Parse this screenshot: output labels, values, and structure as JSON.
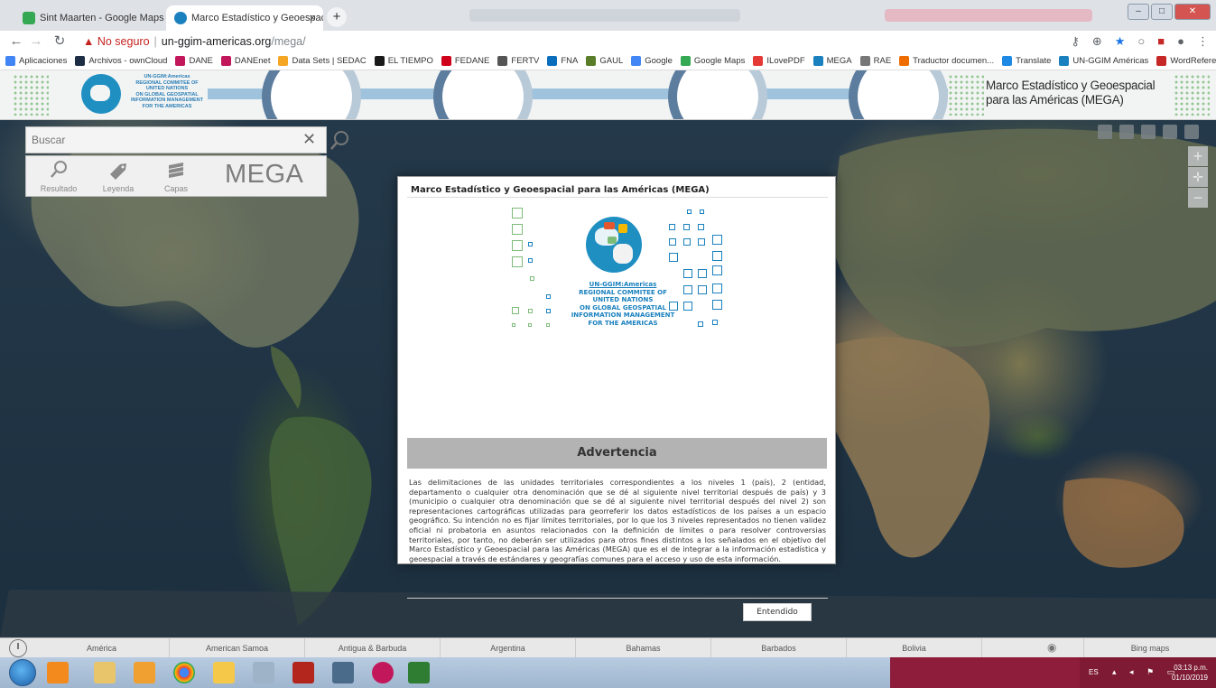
{
  "browser": {
    "tabs": [
      {
        "title": "Sint Maarten - Google Maps",
        "favicon_color": "#34a853"
      },
      {
        "title": "Marco Estadístico y Geoespacial",
        "favicon_color": "#1a81be"
      }
    ],
    "address": {
      "security_label": "No seguro",
      "host": "un-ggim-americas.org",
      "path": "/mega/"
    },
    "bookmarks": [
      {
        "label": "Aplicaciones",
        "color": "#4285f4"
      },
      {
        "label": "Archivos - ownCloud",
        "color": "#1d2d44"
      },
      {
        "label": "DANE",
        "color": "#c2185b"
      },
      {
        "label": "DANEnet",
        "color": "#c2185b"
      },
      {
        "label": "Data Sets | SEDAC",
        "color": "#f5a623"
      },
      {
        "label": "EL TIEMPO",
        "color": "#1a1a1a"
      },
      {
        "label": "FEDANE",
        "color": "#d0021b"
      },
      {
        "label": "FERTV",
        "color": "#555555"
      },
      {
        "label": "FNA",
        "color": "#0a6ebd"
      },
      {
        "label": "GAUL",
        "color": "#5a7d2a"
      },
      {
        "label": "Google",
        "color": "#4285f4"
      },
      {
        "label": "Google Maps",
        "color": "#34a853"
      },
      {
        "label": "ILovePDF",
        "color": "#e53935"
      },
      {
        "label": "MEGA",
        "color": "#1a81be"
      },
      {
        "label": "RAE",
        "color": "#777777"
      },
      {
        "label": "Traductor documen...",
        "color": "#ef6c00"
      },
      {
        "label": "Translate",
        "color": "#1e88e5"
      },
      {
        "label": "UN-GGIM Américas",
        "color": "#1a81be"
      },
      {
        "label": "WordReference",
        "color": "#c62828"
      }
    ]
  },
  "banner": {
    "org_lines": [
      "UN-GGIM:Americas",
      "REGIONAL COMMITEE OF",
      "UNITED NATIONS",
      "ON GLOBAL GEOSPATIAL",
      "INFORMATION MANAGEMENT",
      "FOR THE AMERICAS"
    ],
    "headline_line1": "Marco Estadístico y Geoespacial",
    "headline_line2": "para las Américas (MEGA)"
  },
  "search": {
    "placeholder": "Buscar"
  },
  "tools": {
    "resultado": "Resultado",
    "leyenda": "Leyenda",
    "capas": "Capas",
    "brand": "MEGA"
  },
  "modal": {
    "title": "Marco Estadístico y Geoespacial para las Américas (MEGA)",
    "logo_lines": [
      "UN-GGIM:Americas",
      "REGIONAL COMMITEE OF",
      "UNITED NATIONS",
      "ON GLOBAL GEOSPATIAL",
      "INFORMATION MANAGEMENT",
      "FOR THE AMERICAS"
    ],
    "heading": "Advertencia",
    "body": "Las delimitaciones de las unidades territoriales correspondientes a los niveles 1 (país), 2 (entidad, departamento o cualquier otra denominación que se dé al siguiente nivel territorial después de país) y 3 (municipio o cualquier otra denominación que se dé al siguiente nivel territorial después del nivel 2) son representaciones cartográficas utilizadas para georreferir los datos estadísticos de los países a un espacio geográfico. Su intención no es fijar límites territoriales, por lo que los 3 niveles representados no tienen validez oficial ni probatoria en asuntos relacionados con la definición de límites o para resolver controversias territoriales, por tanto, no deberán ser utilizados para otros fines distintos a los señalados en el objetivo del Marco Estadístico y Geoespacial para las Américas (MEGA) que es el de integrar a la información estadística y geoespacial a través de estándares y geografías comunes para el acceso y uso de esta información.",
    "button": "Entendido"
  },
  "countries": [
    "América",
    "American Samoa",
    "Antigua & Barbuda",
    "Argentina",
    "Bahamas",
    "Barbados",
    "Bolivia"
  ],
  "basemap": "Bing maps",
  "taskbar": {
    "lang": "ES",
    "time": "03:13 p.m.",
    "date": "01/10/2019"
  },
  "colors": {
    "accent": "#1a81be",
    "warning_bar": "#b3b3b3",
    "insecure": "#c5221f"
  }
}
